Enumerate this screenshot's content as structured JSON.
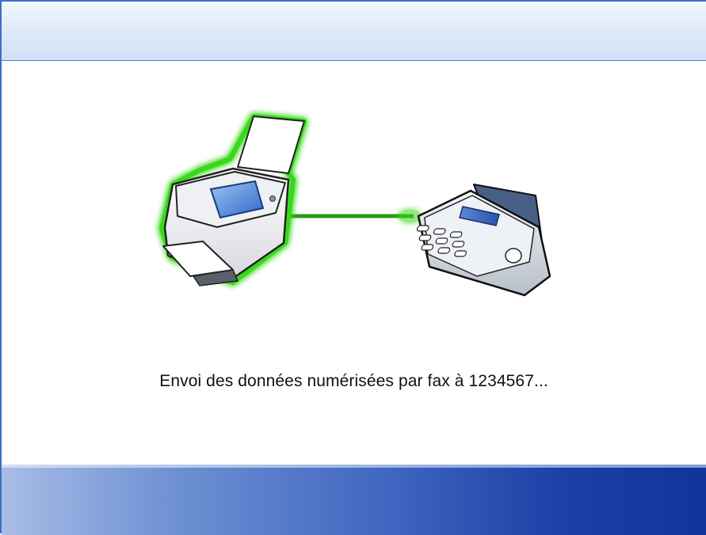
{
  "status": {
    "message": "Envoi des données numérisées par fax à 1234567..."
  },
  "illustration": {
    "source_device": "scanner-icon",
    "target_device": "fax-machine-icon",
    "connection_color": "#2e9a12",
    "highlight_color": "#39d81a"
  },
  "colors": {
    "window_border": "#3c6fc4",
    "bottom_bar_start": "#a8bde6",
    "bottom_bar_end": "#12339a"
  }
}
